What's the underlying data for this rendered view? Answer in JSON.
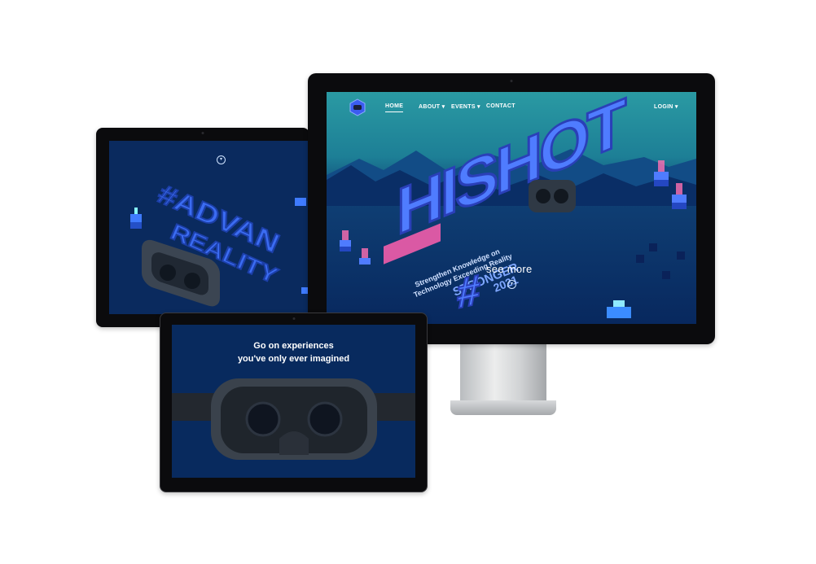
{
  "monitor": {
    "nav": {
      "items": [
        {
          "label": "HOME"
        },
        {
          "label": "ABOUT ▾"
        },
        {
          "label": "EVENTS ▾"
        },
        {
          "label": "CONTACT"
        }
      ],
      "login_label": "LOGIN ▾"
    },
    "hero": {
      "logo_text": "HISHOT",
      "tagline_line1": "Strengthen Knowledge on",
      "tagline_line2": "Technology Exceeding Reality",
      "tagline_line3": "STRONGER",
      "tagline_year": "2021",
      "see_more_label": "see more",
      "hash_text": "#"
    }
  },
  "tablet": {
    "hero_line1": "#ADVAN",
    "hero_line2": "REALITY"
  },
  "tablet2": {
    "headline_line1": "Go on experiences",
    "headline_line2": "you've only ever imagined"
  },
  "colors": {
    "teal_sky": "#2a9aa3",
    "deep_navy": "#08285e",
    "neon_blue": "#4f7cff",
    "neon_pink": "#ff5fae"
  },
  "icons": [
    "site-logo-icon",
    "chevron-down-icon",
    "vr-headset-icon"
  ]
}
